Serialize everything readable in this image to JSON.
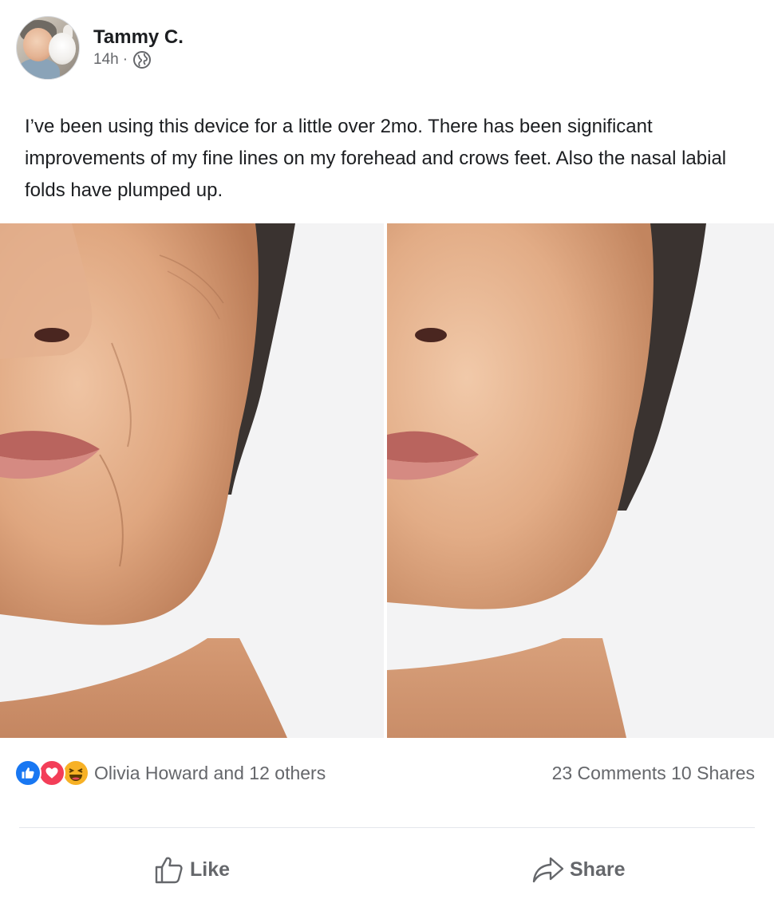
{
  "post": {
    "author": "Tammy C.",
    "time": "14h",
    "separator": "·",
    "audience_icon": "globe-icon",
    "text": "I’ve been using this device for a little over 2mo. There has been significant improvements of my fine lines on my forehead and crows feet. Also the nasal labial folds have plumped up."
  },
  "stats": {
    "reaction_icons": [
      "like-reaction-icon",
      "love-reaction-icon",
      "haha-reaction-icon"
    ],
    "reactors": "Olivia Howard and 12 others",
    "comments": "23 Comments",
    "shares": "10 Shares"
  },
  "actions": {
    "like": "Like",
    "share": "Share"
  },
  "colors": {
    "like_blue": "#1877f2",
    "love_red": "#f33e58",
    "haha_yellow": "#f7b125",
    "secondary_text": "#65676b"
  }
}
